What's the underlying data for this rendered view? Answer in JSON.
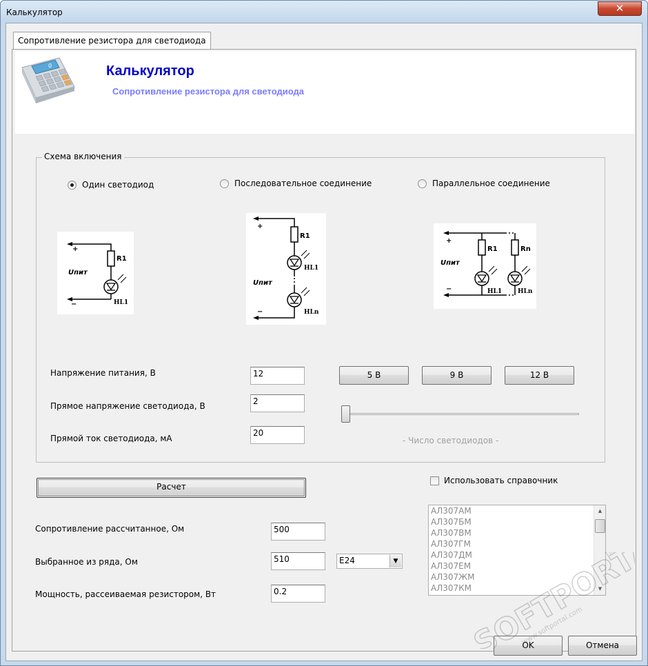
{
  "window": {
    "title": "Калькулятор",
    "close_symbol": "✕"
  },
  "tab": {
    "label": "Сопротивление резистора для светодиода"
  },
  "header": {
    "title": "Калькулятор",
    "subtitle": "Сопротивление резистора для светодиода",
    "icon": "calculator-icon"
  },
  "scheme": {
    "legend": "Схема включения",
    "options": [
      {
        "label": "Один светодиод",
        "checked": true
      },
      {
        "label": "Последовательное соединение",
        "checked": false
      },
      {
        "label": "Параллельное соединение",
        "checked": false
      }
    ],
    "diagram_labels": {
      "plus": "+",
      "minus": "−",
      "upit": "Uпит",
      "r1": "R1",
      "rn": "Rn",
      "hl1": "HL1",
      "hln": "HLn"
    }
  },
  "inputs": {
    "supply_label": "Напряжение питания, В",
    "supply_value": "12",
    "forward_voltage_label": "Прямое напряжение светодиода, В",
    "forward_voltage_value": "2",
    "forward_current_label": "Прямой ток светодиода, мА",
    "forward_current_value": "20"
  },
  "voltage_presets": [
    "5 В",
    "9 В",
    "12 В"
  ],
  "led_count": {
    "caption": "- Число светодиодов -",
    "level": 0
  },
  "calculate_button": "Расчет",
  "use_reference_label": "Использовать справочник",
  "reference_list": [
    "АЛ307АМ",
    "АЛ307БМ",
    "АЛ307ВМ",
    "АЛ307ГМ",
    "АЛ307ДМ",
    "АЛ307ЕМ",
    "АЛ307ЖМ",
    "АЛ307КМ"
  ],
  "results": {
    "calculated_label": "Сопротивление рассчитанное, Ом",
    "calculated_value": "500",
    "selected_label": "Выбранное из ряда, Ом",
    "selected_value": "510",
    "series_value": "E24",
    "power_label": "Мощность, рассеиваемая резистором, Вт",
    "power_value": "0.2"
  },
  "footer": {
    "ok": "OK",
    "cancel": "Отмена"
  },
  "watermark": {
    "brand": "SOFTPORTAL",
    "url": "www.softportal.com",
    "tm": "TM"
  }
}
